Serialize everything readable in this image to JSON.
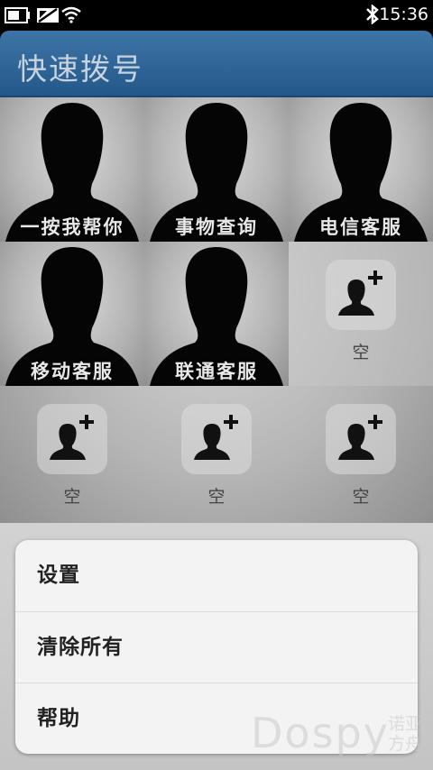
{
  "status_bar": {
    "time": "15:36",
    "icons": [
      "battery-icon",
      "signal-off-icon",
      "wifi-icon",
      "bluetooth-icon"
    ]
  },
  "app": {
    "title": "快速拨号"
  },
  "speed_dial": {
    "contacts": [
      {
        "name": "一按我帮你"
      },
      {
        "name": "事物查询"
      },
      {
        "name": "电信客服"
      },
      {
        "name": "移动客服"
      },
      {
        "name": "联通客服"
      }
    ],
    "empty_label": "空",
    "empty_slots": 4
  },
  "menu": {
    "items": [
      {
        "label": "设置"
      },
      {
        "label": "清除所有"
      },
      {
        "label": "帮助"
      }
    ]
  },
  "watermark": {
    "text": "Dospy",
    "side_text": "诺亚方舟"
  },
  "colors": {
    "appbar": "#2f659a",
    "menu_bg": "#f3f3f3"
  }
}
